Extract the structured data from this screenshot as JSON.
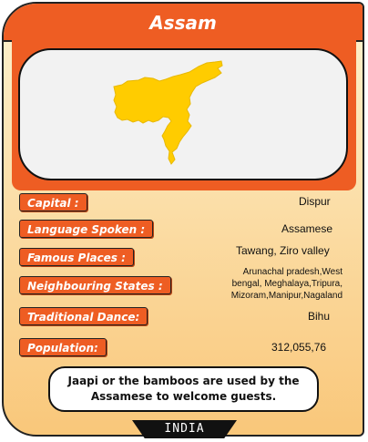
{
  "card": {
    "title": "Assam",
    "footer": "INDIA",
    "fact": "Jaapi or the bamboos are used by the Assamese to welcome guests."
  },
  "map": {
    "icon": "assam-map-icon",
    "fill_color": "#ffcc00"
  },
  "facts": [
    {
      "label": "Capital :",
      "value": "Dispur"
    },
    {
      "label": "Language Spoken :",
      "value": "Assamese"
    },
    {
      "label": "Famous Places :",
      "value": "Tawang, Ziro valley"
    },
    {
      "label": "Neighbouring States :",
      "value": "Arunachal pradesh,West bengal, Meghalaya,Tripura, Mizoram,Manipur,Nagaland"
    },
    {
      "label": "Traditional Dance:",
      "value": "Bihu"
    },
    {
      "label": "Population:",
      "value": "312,055,76"
    }
  ],
  "colors": {
    "accent": "#ee5d23",
    "background_top": "#fdf2cf",
    "background_bottom": "#f9c77a"
  }
}
